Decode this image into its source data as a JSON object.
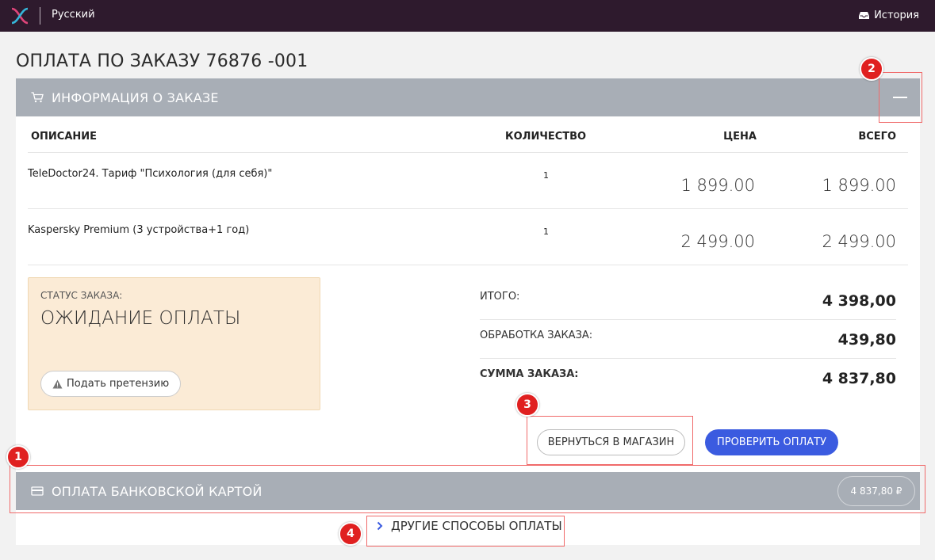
{
  "topbar": {
    "language": "Русский",
    "history_label": "История"
  },
  "page": {
    "title": "ОПЛАТА ПО ЗАКАЗУ 76876 -001"
  },
  "order_info": {
    "title": "ИНФОРМАЦИЯ О ЗАКАЗЕ",
    "columns": {
      "description": "ОПИСАНИЕ",
      "quantity": "КОЛИЧЕСТВО",
      "price": "ЦЕНА",
      "total": "ВСЕГО"
    },
    "items": [
      {
        "description": "TeleDoctor24. Тариф \"Психология (для себя)\"",
        "quantity": "1",
        "price": "1 899.00",
        "total": "1 899.00"
      },
      {
        "description": "Kaspersky Premium (3 устройства+1 год)",
        "quantity": "1",
        "price": "2 499.00",
        "total": "2 499.00"
      }
    ]
  },
  "status": {
    "label": "СТАТУС ЗАКАЗА:",
    "value": "ОЖИДАНИЕ ОПЛАТЫ",
    "claim_button": "Подать претензию"
  },
  "summary": {
    "subtotal_label": "ИТОГО:",
    "subtotal_value": "4 398,00",
    "fee_label": "ОБРАБОТКА ЗАКАЗА:",
    "fee_value": "439,80",
    "sum_label": "СУММА ЗАКАЗА:",
    "sum_value": "4 837,80"
  },
  "actions": {
    "back_button": "ВЕРНУТЬСЯ В МАГАЗИН",
    "check_button": "ПРОВЕРИТЬ ОПЛАТУ"
  },
  "card_payment": {
    "title": "ОПЛАТА БАНКОВСКОЙ КАРТОЙ",
    "amount": "4 837,80 ₽"
  },
  "other_methods": {
    "label": "ДРУГИЕ СПОСОБЫ ОПЛАТЫ"
  },
  "markers": [
    "1",
    "2",
    "3",
    "4"
  ],
  "colors": {
    "topbar": "#2e1a2d",
    "section_bar": "#a8aeb6",
    "primary_button": "#3b5be0",
    "status_box": "#fbebd6",
    "annotation": "#e02020"
  }
}
